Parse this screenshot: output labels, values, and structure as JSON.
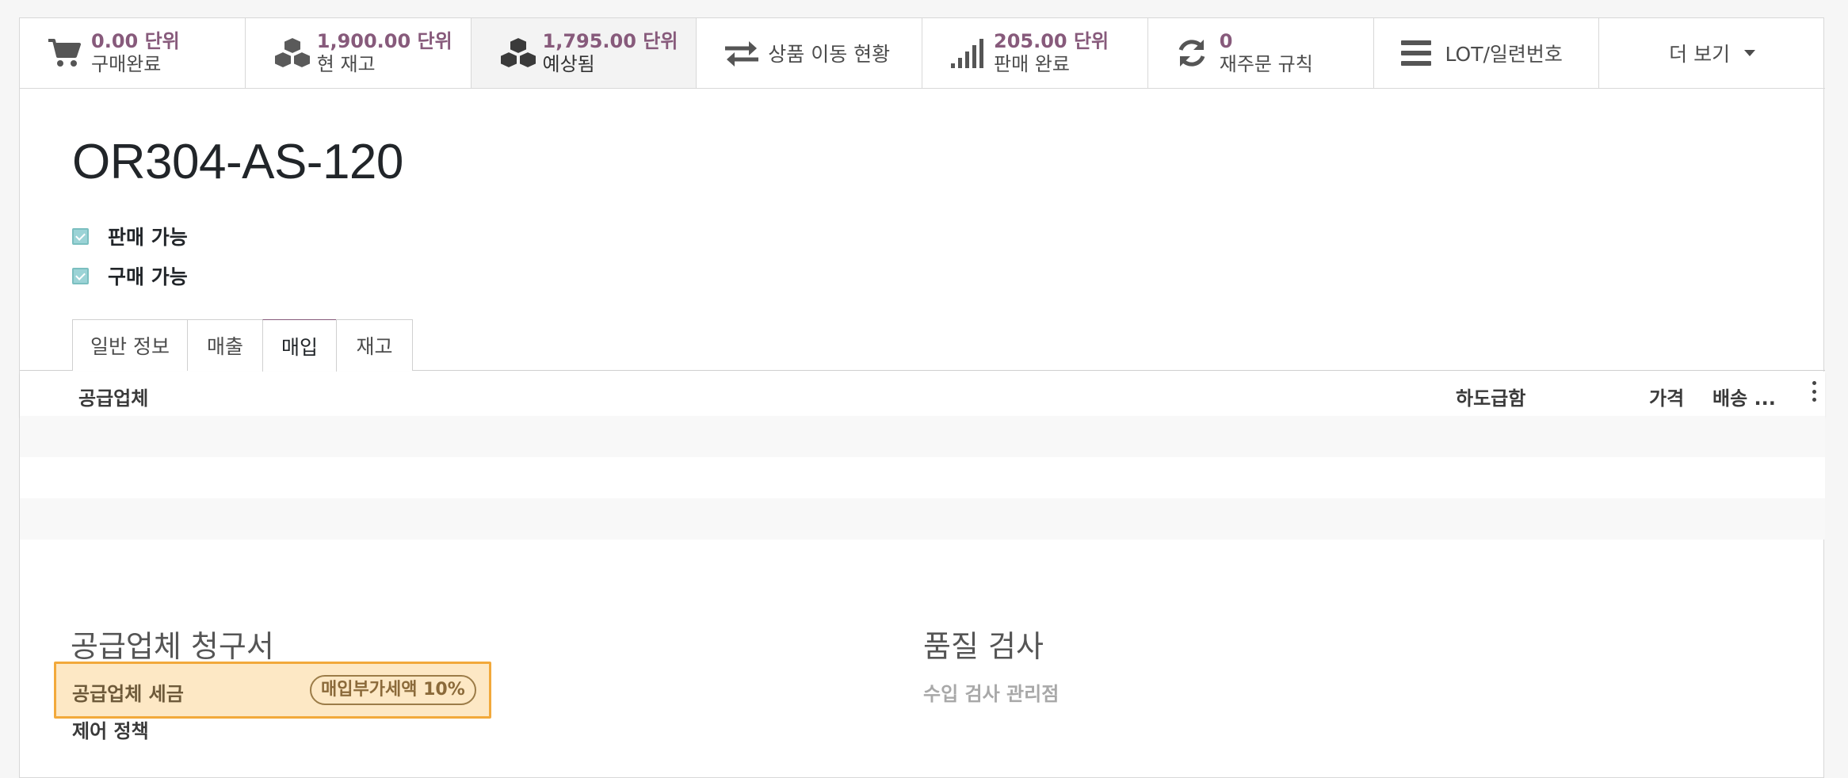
{
  "smart_buttons": [
    {
      "icon": "cart-icon",
      "value": "0.00 단위",
      "label": "구매완료"
    },
    {
      "icon": "cubes-icon",
      "value": "1,900.00 단위",
      "label": "현 재고"
    },
    {
      "icon": "cubes-icon",
      "value": "1,795.00 단위",
      "label": "예상됨",
      "active": true
    },
    {
      "icon": "exchange-icon",
      "label": "상품 이동 현황"
    },
    {
      "icon": "signal-icon",
      "value": "205.00 단위",
      "label": "판매 완료"
    },
    {
      "icon": "refresh-icon",
      "value": "0",
      "label": "재주문 규칙"
    },
    {
      "icon": "bars-icon",
      "label": "LOT/일련번호"
    },
    {
      "label": "더 보기",
      "icon": "caret-down-icon"
    }
  ],
  "product": {
    "name": "OR304-AS-120",
    "sale_ok_label": "판매 가능",
    "purchase_ok_label": "구매 가능"
  },
  "tabs": [
    "일반 정보",
    "매출",
    "매입",
    "재고"
  ],
  "active_tab": "매입",
  "supplier_table": {
    "columns": [
      "공급업체",
      "하도급함",
      "가격",
      "배송 ..."
    ]
  },
  "vendor_bills": {
    "title": "공급업체 청구서",
    "tax_label": "공급업체 세금",
    "tax_value": "매입부가세액 10%",
    "control_policy_label": "제어 정책"
  },
  "quality": {
    "title": "품질 검사",
    "control_points_label": "수입 검사 관리점"
  },
  "colors": {
    "accent": "#875a7b",
    "checkbox": "#9bd3d6",
    "highlight_bg": "#fde8c5",
    "highlight_border": "#f2a93b"
  }
}
